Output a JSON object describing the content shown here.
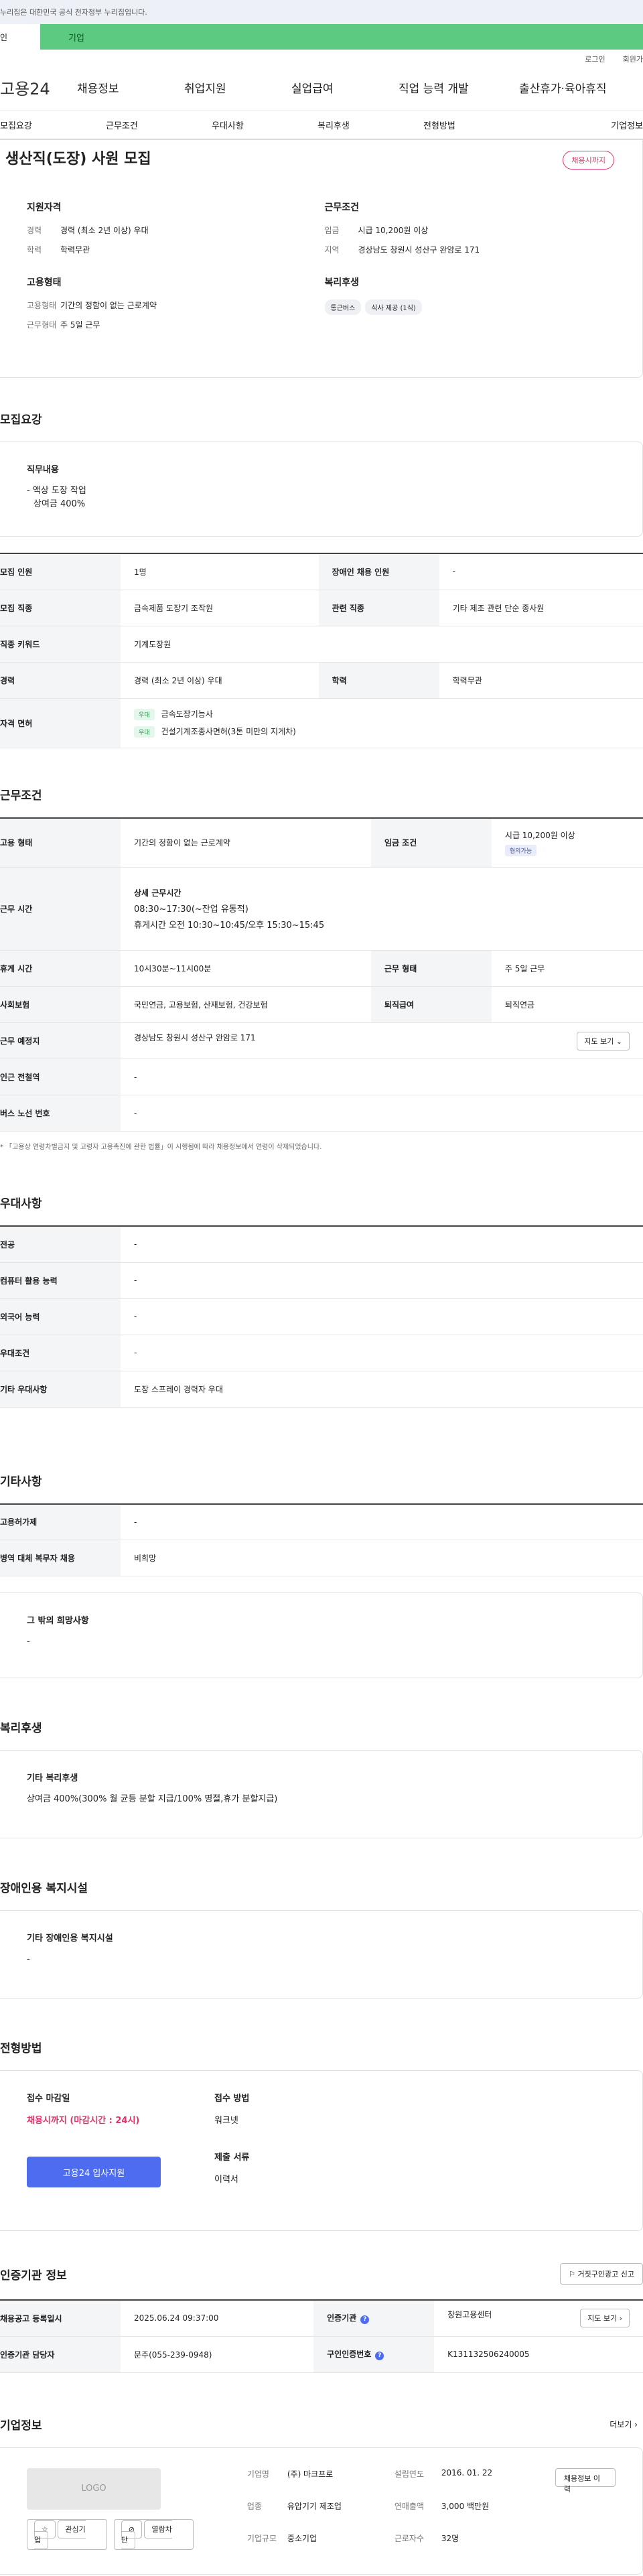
{
  "notice": "누리집은 대한민국 공식 전자정부 누리집입니다.",
  "user_tabs": [
    "인",
    "기업"
  ],
  "util": [
    "로그인",
    "회원가"
  ],
  "logo": "고용24",
  "gnb": [
    "채용정보",
    "취업지원",
    "실업급여",
    "직업 능력 개발",
    "출산휴가·육아휴직"
  ],
  "subnav": [
    "모집요강",
    "근무조건",
    "우대사항",
    "복리후생",
    "전형방법",
    "기업정보"
  ],
  "summary": {
    "title": "생산직(도장) 사원 모집",
    "badge": "채용시까지",
    "qual_h": "지원자격",
    "career_k": "경력",
    "career_v": "경력 (최소 2년 이상) 우대",
    "edu_k": "학력",
    "edu_v": "학력무관",
    "emp_h": "고용형태",
    "emp_k": "고용형태",
    "emp_v": "기간의 정함이 없는 근로계약",
    "work_k": "근무형태",
    "work_v": "주 5일 근무",
    "cond_h": "근무조건",
    "wage_k": "임금",
    "wage_v": "시급 10,200원 이상",
    "loc_k": "지역",
    "loc_v": "경상남도 창원시 성산구 완암로 171",
    "welfare_h": "복리후생",
    "chips": [
      "통근버스",
      "식사 제공 (1식)"
    ]
  },
  "recruit": {
    "title": "모집요강",
    "duty_h": "직무내용",
    "duty_1": "- 액상 도장 작업",
    "duty_2": "상여금 400%",
    "rows": {
      "people_k": "모집 인원",
      "people_v": "1명",
      "dis_k": "장애인 채용 인원",
      "dis_v": "-",
      "job_k": "모집 직종",
      "job_v": "금속제품 도장기 조작원",
      "rel_k": "관련 직종",
      "rel_v": "기타 제조 관련 단순 종사원",
      "kw_k": "직종 키워드",
      "kw_v": "기계도장원",
      "car_k": "경력",
      "car_v": "경력 (최소 2년 이상) 우대",
      "edu_k": "학력",
      "edu_v": "학력무관",
      "lic_k": "자격 면허",
      "lic_tag": "우대",
      "lic_1": "금속도장기능사",
      "lic_2": "건설기계조종사면허(3톤 미만의 지게차)"
    }
  },
  "work": {
    "title": "근무조건",
    "emp_k": "고용 형태",
    "emp_v": "기간의 정함이 없는 근로계약",
    "wage_k": "임금 조건",
    "wage_v": "시급 10,200원 이상",
    "wage_tag": "협의가능",
    "time_k": "근무 시간",
    "time_h": "상세 근무시간",
    "time_1": "08:30~17:30(~잔업 유동적)",
    "time_2": "휴게시간 오전 10:30~10:45/오후 15:30~15:45",
    "rest_k": "휴게 시간",
    "rest_v": "10시30분~11시00분",
    "form_k": "근무 형태",
    "form_v": "주 5일 근무",
    "ins_k": "사회보험",
    "ins_v": "국민연금, 고용보험, 산재보험, 건강보험",
    "ret_k": "퇴직급여",
    "ret_v": "퇴직연금",
    "place_k": "근무 예정지",
    "place_v": "경상남도 창원시 성산구 완암로 171",
    "map_btn": "지도 보기",
    "sub_k": "인근 전철역",
    "sub_v": "-",
    "bus_k": "버스 노선 번호",
    "bus_v": "-",
    "note": "「고용상 연령차별금지 및 고령자 고용촉진에 관한 법률」이 시행됨에 따라 채용정보에서 연령이 삭제되었습니다."
  },
  "pref": {
    "title": "우대사항",
    "major_k": "전공",
    "major_v": "-",
    "pc_k": "컴퓨터 활용 능력",
    "pc_v": "-",
    "lang_k": "외국어 능력",
    "lang_v": "-",
    "cond_k": "우대조건",
    "cond_v": "-",
    "etc_k": "기타 우대사항",
    "etc_v": "도장 스프레이 경력자 우대"
  },
  "etc": {
    "title": "기타사항",
    "perm_k": "고용허가제",
    "perm_v": "-",
    "mil_k": "병역 대체 복무자 채용",
    "mil_v": "비희망",
    "wish_h": "그 밖의 희망사항",
    "wish_v": "-"
  },
  "welfare": {
    "title": "복리후생",
    "h": "기타 복리후생",
    "v": "상여금 400%(300% 월 균등 분할 지급/100% 명절,휴가 분할지급)"
  },
  "disab": {
    "title": "장애인용 복지시설",
    "h": "기타 장애인용 복지시설",
    "v": "-"
  },
  "process": {
    "title": "전형방법",
    "dl_h": "접수 마감일",
    "dl_v": "채용시까지 (마감시간 : 24시)",
    "apply_btn": "고용24 입사지원",
    "m_h": "접수 방법",
    "m_v": "워크넷",
    "doc_h": "제출 서류",
    "doc_v": "이력서"
  },
  "cert": {
    "title": "인증기관 정보",
    "report": "거짓구인광고 신고",
    "reg_k": "채용공고 등록일시",
    "reg_v": "2025.06.24 09:37:00",
    "org_k": "인증기관",
    "org_v": "창원고용센터",
    "map_btn": "지도 보기",
    "mgr_k": "인증기관 담당자",
    "mgr_v": "문주(055-239-0948)",
    "num_k": "구인인증번호",
    "num_v": "K131132506240005"
  },
  "company": {
    "title": "기업정보",
    "more": "더보기",
    "logo": "LOGO",
    "fav": "관심기업",
    "block": "열람차단",
    "name_k": "기업명",
    "name_v": "(주) 마크프로",
    "est_k": "설립연도",
    "est_v": "2016. 01. 22",
    "ind_k": "업종",
    "ind_v": "유압기기 제조업",
    "sales_k": "연매출액",
    "sales_v": "3,000 백만원",
    "size_k": "기업규모",
    "size_v": "중소기업",
    "emp_k": "근로자수",
    "emp_v": "32명",
    "hist": "채용정보 이력"
  }
}
